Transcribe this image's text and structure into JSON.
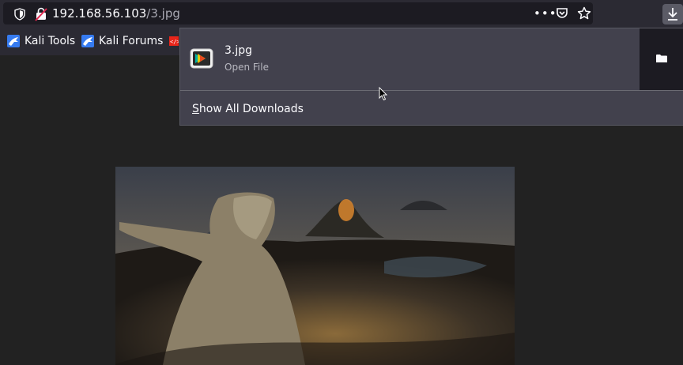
{
  "urlbar": {
    "host": "192.168.56.103",
    "path": "/3.jpg",
    "more_label": "•••"
  },
  "bookmarks": [
    {
      "label": "Kali Tools",
      "icon": "kali-dragon-icon"
    },
    {
      "label": "Kali Forums",
      "icon": "kali-dragon-icon"
    },
    {
      "label": "",
      "icon": "exploit-db-icon"
    }
  ],
  "downloads": {
    "item": {
      "filename": "3.jpg",
      "status": "Open File",
      "icon": "image-file-icon"
    },
    "show_all_accesskey": "S",
    "show_all_rest": "how All Downloads"
  },
  "colors": {
    "toolbar": "#2b2a33",
    "urlbar": "#1c1b22",
    "panel": "#42414d",
    "page_bg": "#222222"
  }
}
